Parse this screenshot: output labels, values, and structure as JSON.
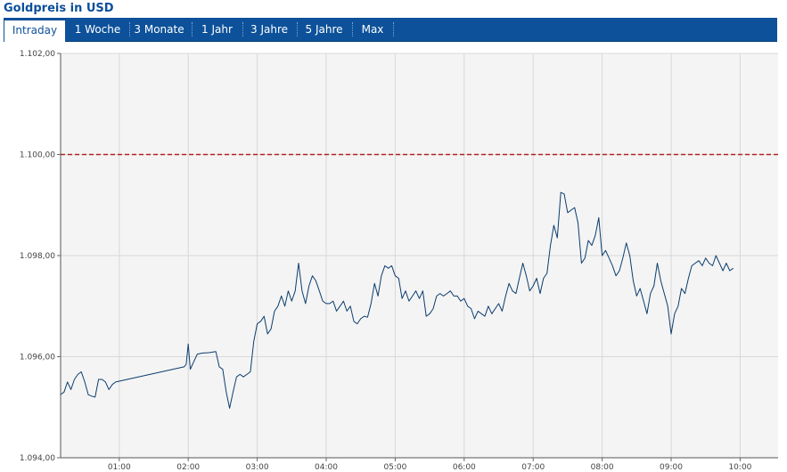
{
  "title": "Goldpreis in USD",
  "tabs": [
    {
      "label": "Intraday",
      "active": true
    },
    {
      "label": "1 Woche",
      "active": false
    },
    {
      "label": "3 Monate",
      "active": false
    },
    {
      "label": "1 Jahr",
      "active": false
    },
    {
      "label": "3 Jahre",
      "active": false
    },
    {
      "label": "5 Jahre",
      "active": false
    },
    {
      "label": "Max",
      "active": false
    }
  ],
  "colors": {
    "accent": "#0d519a",
    "line": "#0b3d6e",
    "reference": "#b22222",
    "plot_bg": "#f4f4f4",
    "grid": "#d8d8d8"
  },
  "chart_data": {
    "type": "line",
    "title": "Goldpreis in USD",
    "xlabel": "",
    "ylabel": "",
    "x_unit": "hours",
    "xlim": [
      0.15,
      10.55
    ],
    "ylim": [
      1094,
      1102
    ],
    "y_ticks": [
      1094,
      1096,
      1098,
      1100,
      1102
    ],
    "y_tick_labels": [
      "1.094,00",
      "1.096,00",
      "1.098,00",
      "1.100,00",
      "1.102,00"
    ],
    "x_ticks": [
      1,
      2,
      3,
      4,
      5,
      6,
      7,
      8,
      9,
      10
    ],
    "x_tick_labels": [
      "01:00",
      "02:00",
      "03:00",
      "04:00",
      "05:00",
      "06:00",
      "07:00",
      "08:00",
      "09:00",
      "10:00"
    ],
    "grid": true,
    "reference_line": {
      "y": 1100,
      "style": "dashed"
    },
    "series": [
      {
        "points": [
          [
            0.15,
            1095.25
          ],
          [
            0.2,
            1095.3
          ],
          [
            0.25,
            1095.5
          ],
          [
            0.3,
            1095.35
          ],
          [
            0.35,
            1095.55
          ],
          [
            0.4,
            1095.65
          ],
          [
            0.45,
            1095.7
          ],
          [
            0.5,
            1095.5
          ],
          [
            0.55,
            1095.25
          ],
          [
            0.6,
            1095.22
          ],
          [
            0.65,
            1095.2
          ],
          [
            0.7,
            1095.55
          ],
          [
            0.75,
            1095.55
          ],
          [
            0.8,
            1095.5
          ],
          [
            0.85,
            1095.35
          ],
          [
            0.9,
            1095.45
          ],
          [
            0.95,
            1095.5
          ],
          [
            1.94,
            1095.8
          ],
          [
            1.97,
            1095.85
          ],
          [
            2.0,
            1096.25
          ],
          [
            2.03,
            1095.75
          ],
          [
            2.08,
            1095.9
          ],
          [
            2.13,
            1096.05
          ],
          [
            2.2,
            1096.07
          ],
          [
            2.3,
            1096.08
          ],
          [
            2.4,
            1096.1
          ],
          [
            2.45,
            1095.8
          ],
          [
            2.5,
            1095.75
          ],
          [
            2.55,
            1095.3
          ],
          [
            2.6,
            1094.98
          ],
          [
            2.65,
            1095.3
          ],
          [
            2.7,
            1095.6
          ],
          [
            2.75,
            1095.65
          ],
          [
            2.8,
            1095.6
          ],
          [
            2.85,
            1095.65
          ],
          [
            2.9,
            1095.7
          ],
          [
            2.95,
            1096.3
          ],
          [
            3.0,
            1096.65
          ],
          [
            3.05,
            1096.7
          ],
          [
            3.1,
            1096.8
          ],
          [
            3.15,
            1096.45
          ],
          [
            3.2,
            1096.55
          ],
          [
            3.25,
            1096.9
          ],
          [
            3.3,
            1097.0
          ],
          [
            3.35,
            1097.2
          ],
          [
            3.4,
            1097.0
          ],
          [
            3.45,
            1097.3
          ],
          [
            3.5,
            1097.1
          ],
          [
            3.55,
            1097.3
          ],
          [
            3.6,
            1097.85
          ],
          [
            3.65,
            1097.3
          ],
          [
            3.7,
            1097.05
          ],
          [
            3.75,
            1097.4
          ],
          [
            3.8,
            1097.6
          ],
          [
            3.85,
            1097.5
          ],
          [
            3.9,
            1097.3
          ],
          [
            3.95,
            1097.1
          ],
          [
            4.0,
            1097.05
          ],
          [
            4.05,
            1097.05
          ],
          [
            4.1,
            1097.1
          ],
          [
            4.15,
            1096.9
          ],
          [
            4.2,
            1097.0
          ],
          [
            4.25,
            1097.1
          ],
          [
            4.3,
            1096.9
          ],
          [
            4.35,
            1097.0
          ],
          [
            4.4,
            1096.7
          ],
          [
            4.45,
            1096.65
          ],
          [
            4.5,
            1096.75
          ],
          [
            4.55,
            1096.8
          ],
          [
            4.6,
            1096.78
          ],
          [
            4.65,
            1097.05
          ],
          [
            4.7,
            1097.45
          ],
          [
            4.75,
            1097.2
          ],
          [
            4.8,
            1097.6
          ],
          [
            4.85,
            1097.8
          ],
          [
            4.9,
            1097.75
          ],
          [
            4.95,
            1097.8
          ],
          [
            5.0,
            1097.6
          ],
          [
            5.05,
            1097.55
          ],
          [
            5.1,
            1097.15
          ],
          [
            5.15,
            1097.3
          ],
          [
            5.2,
            1097.1
          ],
          [
            5.25,
            1097.2
          ],
          [
            5.3,
            1097.3
          ],
          [
            5.35,
            1097.15
          ],
          [
            5.4,
            1097.3
          ],
          [
            5.45,
            1096.8
          ],
          [
            5.5,
            1096.85
          ],
          [
            5.55,
            1096.95
          ],
          [
            5.6,
            1097.2
          ],
          [
            5.65,
            1097.25
          ],
          [
            5.7,
            1097.2
          ],
          [
            5.75,
            1097.25
          ],
          [
            5.8,
            1097.3
          ],
          [
            5.85,
            1097.2
          ],
          [
            5.9,
            1097.2
          ],
          [
            5.95,
            1097.1
          ],
          [
            6.0,
            1097.15
          ],
          [
            6.05,
            1097.0
          ],
          [
            6.1,
            1096.95
          ],
          [
            6.15,
            1096.75
          ],
          [
            6.2,
            1096.9
          ],
          [
            6.25,
            1096.85
          ],
          [
            6.3,
            1096.8
          ],
          [
            6.35,
            1097.0
          ],
          [
            6.4,
            1096.85
          ],
          [
            6.45,
            1096.95
          ],
          [
            6.5,
            1097.05
          ],
          [
            6.55,
            1096.9
          ],
          [
            6.6,
            1097.2
          ],
          [
            6.65,
            1097.45
          ],
          [
            6.7,
            1097.3
          ],
          [
            6.75,
            1097.25
          ],
          [
            6.8,
            1097.55
          ],
          [
            6.85,
            1097.85
          ],
          [
            6.9,
            1097.6
          ],
          [
            6.95,
            1097.3
          ],
          [
            7.0,
            1097.4
          ],
          [
            7.05,
            1097.55
          ],
          [
            7.1,
            1097.25
          ],
          [
            7.15,
            1097.55
          ],
          [
            7.2,
            1097.65
          ],
          [
            7.25,
            1098.2
          ],
          [
            7.3,
            1098.6
          ],
          [
            7.35,
            1098.35
          ],
          [
            7.4,
            1099.25
          ],
          [
            7.45,
            1099.22
          ],
          [
            7.5,
            1098.85
          ],
          [
            7.55,
            1098.9
          ],
          [
            7.6,
            1098.95
          ],
          [
            7.65,
            1098.65
          ],
          [
            7.7,
            1097.85
          ],
          [
            7.75,
            1097.95
          ],
          [
            7.8,
            1098.3
          ],
          [
            7.85,
            1098.2
          ],
          [
            7.9,
            1098.4
          ],
          [
            7.95,
            1098.75
          ],
          [
            8.0,
            1098.0
          ],
          [
            8.05,
            1098.1
          ],
          [
            8.1,
            1097.95
          ],
          [
            8.15,
            1097.8
          ],
          [
            8.2,
            1097.6
          ],
          [
            8.25,
            1097.7
          ],
          [
            8.3,
            1097.95
          ],
          [
            8.35,
            1098.25
          ],
          [
            8.4,
            1098.0
          ],
          [
            8.45,
            1097.5
          ],
          [
            8.5,
            1097.2
          ],
          [
            8.55,
            1097.35
          ],
          [
            8.6,
            1097.1
          ],
          [
            8.65,
            1096.85
          ],
          [
            8.7,
            1097.25
          ],
          [
            8.75,
            1097.4
          ],
          [
            8.8,
            1097.85
          ],
          [
            8.85,
            1097.5
          ],
          [
            8.9,
            1097.25
          ],
          [
            8.95,
            1097.0
          ],
          [
            9.0,
            1096.45
          ],
          [
            9.05,
            1096.85
          ],
          [
            9.1,
            1097.0
          ],
          [
            9.15,
            1097.35
          ],
          [
            9.2,
            1097.25
          ],
          [
            9.25,
            1097.55
          ],
          [
            9.3,
            1097.8
          ],
          [
            9.35,
            1097.85
          ],
          [
            9.4,
            1097.9
          ],
          [
            9.45,
            1097.8
          ],
          [
            9.5,
            1097.95
          ],
          [
            9.55,
            1097.85
          ],
          [
            9.6,
            1097.8
          ],
          [
            9.65,
            1098.0
          ],
          [
            9.7,
            1097.85
          ],
          [
            9.75,
            1097.7
          ],
          [
            9.8,
            1097.85
          ],
          [
            9.85,
            1097.7
          ],
          [
            9.9,
            1097.75
          ]
        ]
      }
    ]
  }
}
